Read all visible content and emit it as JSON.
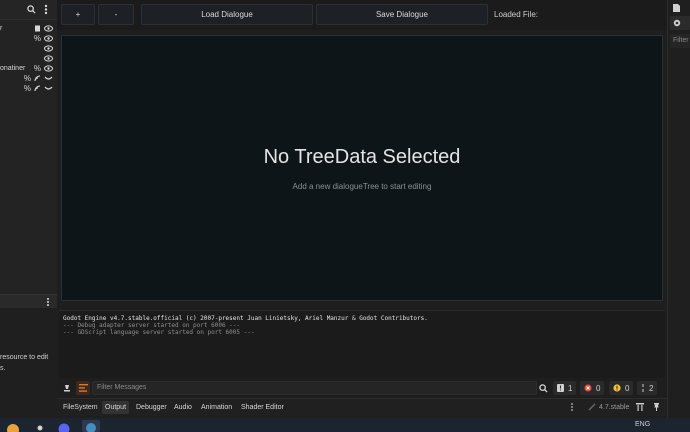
{
  "toolbar": {
    "add_label": "+",
    "remove_label": "-",
    "load_label": "Load Dialogue",
    "save_label": "Save Dialogue",
    "loaded_file_label": "Loaded File:"
  },
  "main": {
    "title": "No TreeData Selected",
    "subtitle": "Add a new dialogueTree to start editing"
  },
  "scene_tree": {
    "rows": [
      {
        "label": "r"
      },
      {
        "label": ""
      },
      {
        "label": ""
      },
      {
        "label": "onatiner"
      },
      {
        "label": ""
      }
    ]
  },
  "left_bottom": {
    "hint_line1": "resource to edit",
    "hint_line2": "s."
  },
  "output": {
    "lines": [
      "Godot Engine v4.7.stable.official (c) 2007-present Juan Linietsky, Ariel Manzur & Godot Contributors.",
      "--- Debug adapter server started on port 6006 ---",
      "--- GDScript language server started on port 6005 ---"
    ]
  },
  "filter": {
    "placeholder": "Filter Messages"
  },
  "counters": {
    "messages": "1",
    "errors": "0",
    "warnings": "0",
    "editor": "2"
  },
  "bottom_tabs": [
    "FileSystem",
    "Output",
    "Debugger",
    "Audio",
    "Animation",
    "Shader Editor"
  ],
  "version": "4.7.stable",
  "right_dock": {
    "filter_label": "Filter"
  },
  "taskbar": {
    "lang": "ENG"
  },
  "colors": {
    "accent": "#e0762d",
    "error": "#e0473c",
    "warning": "#f2c13a",
    "panel_bg": "#0e1518"
  }
}
